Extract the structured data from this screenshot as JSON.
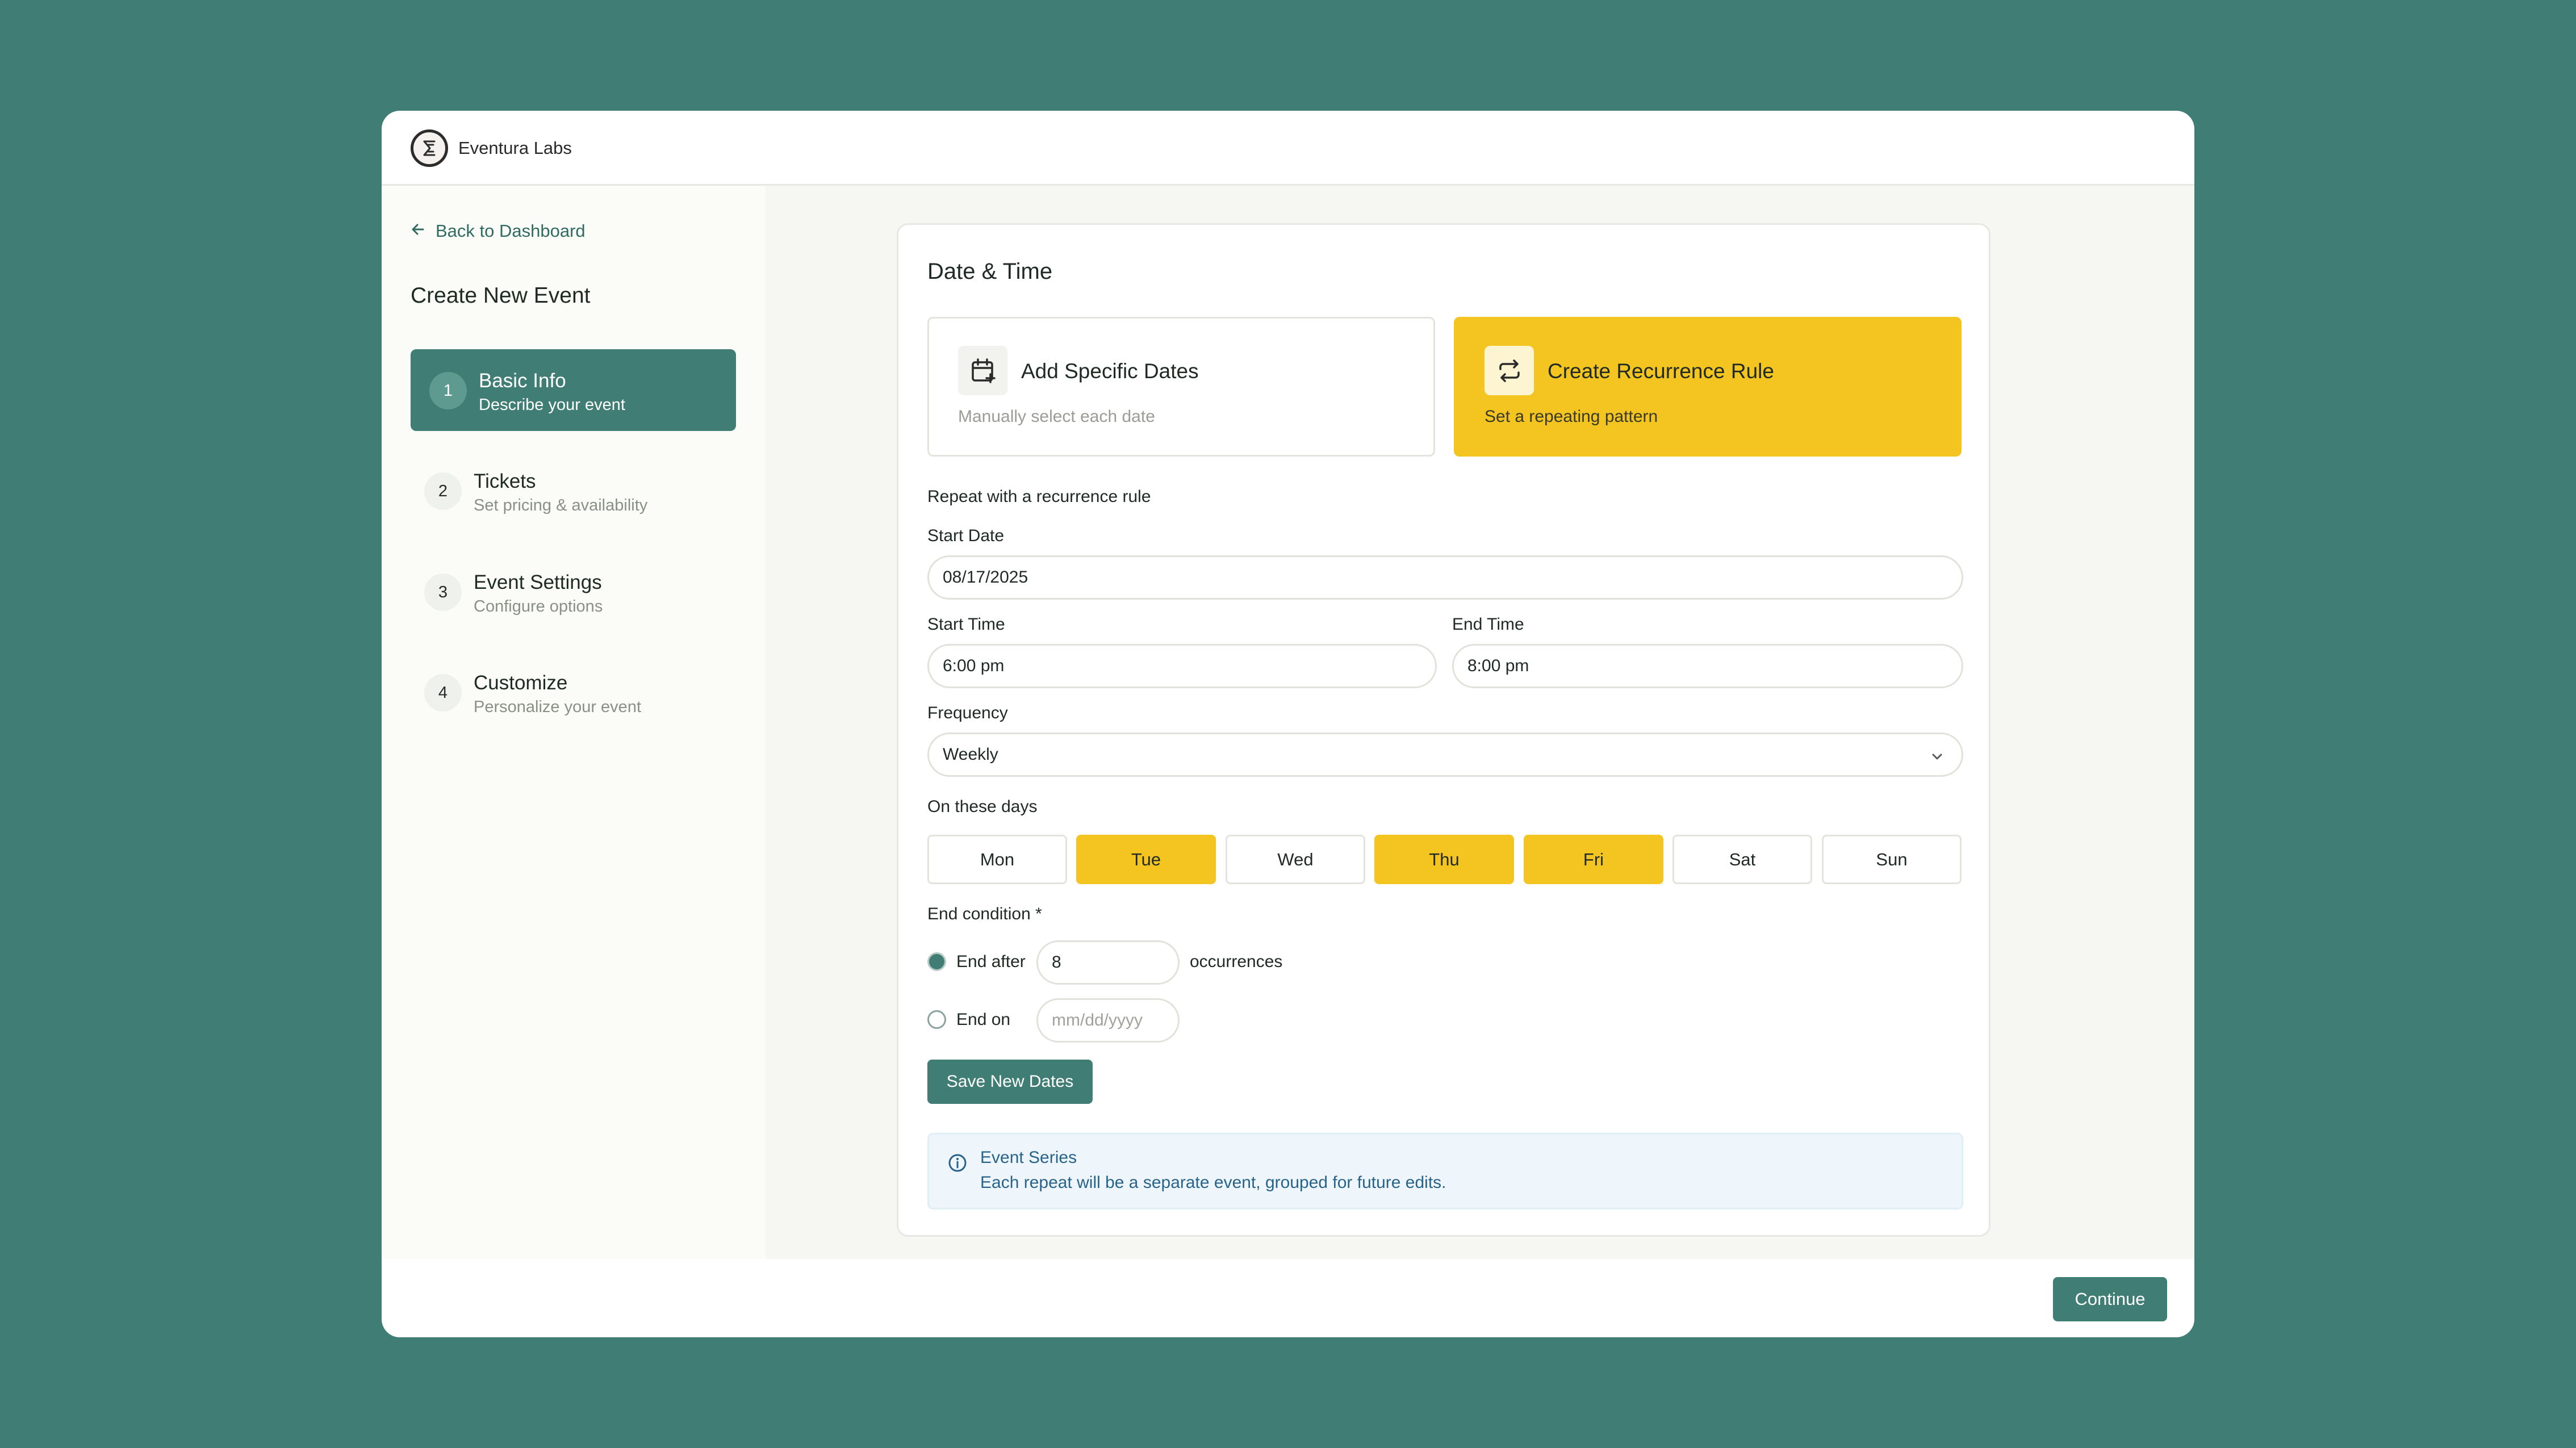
{
  "app": {
    "brand": "Eventura Labs"
  },
  "sidebar": {
    "back_label": "Back to Dashboard",
    "title": "Create New Event",
    "steps": [
      {
        "num": "1",
        "title": "Basic Info",
        "subtitle": "Describe your event",
        "active": true
      },
      {
        "num": "2",
        "title": "Tickets",
        "subtitle": "Set pricing & availability",
        "active": false
      },
      {
        "num": "3",
        "title": "Event Settings",
        "subtitle": "Configure options",
        "active": false
      },
      {
        "num": "4",
        "title": "Customize",
        "subtitle": "Personalize your event",
        "active": false
      }
    ]
  },
  "main": {
    "title": "Date & Time",
    "options": [
      {
        "title": "Add Specific Dates",
        "subtitle": "Manually select each date",
        "icon": "calendar-plus-icon",
        "selected": false
      },
      {
        "title": "Create Recurrence Rule",
        "subtitle": "Set a repeating pattern",
        "icon": "repeat-icon",
        "selected": true
      }
    ],
    "section_heading": "Repeat with a recurrence rule",
    "start_date": {
      "label": "Start Date",
      "value": "08/17/2025"
    },
    "start_time": {
      "label": "Start Time",
      "value": "6:00 pm"
    },
    "end_time": {
      "label": "End Time",
      "value": "8:00 pm"
    },
    "frequency": {
      "label": "Frequency",
      "value": "Weekly"
    },
    "days_label": "On these days",
    "days": [
      {
        "label": "Mon",
        "selected": false
      },
      {
        "label": "Tue",
        "selected": true
      },
      {
        "label": "Wed",
        "selected": false
      },
      {
        "label": "Thu",
        "selected": true
      },
      {
        "label": "Fri",
        "selected": true
      },
      {
        "label": "Sat",
        "selected": false
      },
      {
        "label": "Sun",
        "selected": false
      }
    ],
    "end_condition": {
      "label": "End condition *",
      "after_label": "End after",
      "after_value": "8",
      "after_suffix": "occurrences",
      "on_label": "End on",
      "on_placeholder": "mm/dd/yyyy",
      "selected": "after"
    },
    "save_label": "Save New Dates",
    "info": {
      "title": "Event Series",
      "text": "Each repeat will be a separate event, grouped for future edits."
    }
  },
  "footer": {
    "continue_label": "Continue"
  },
  "colors": {
    "background": "#407d74",
    "accent": "#407d74",
    "highlight": "#f4c420"
  }
}
